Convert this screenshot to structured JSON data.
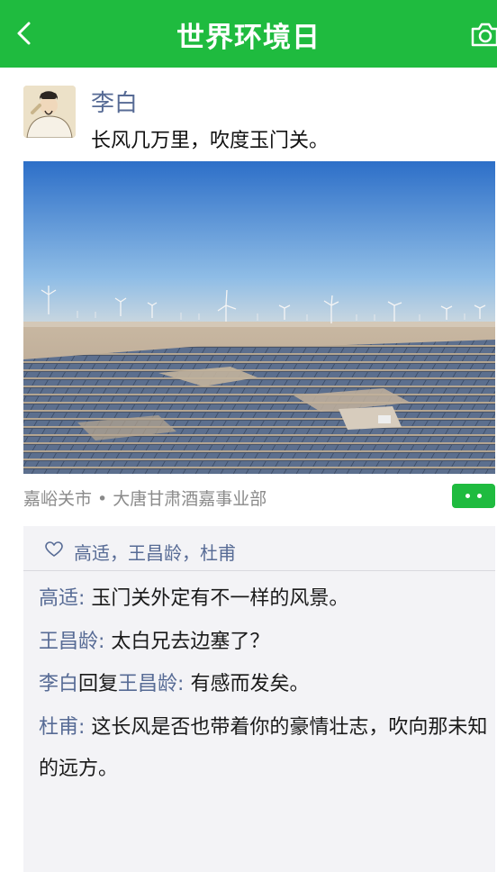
{
  "header": {
    "title": "世界环境日",
    "back_icon": "chevron-left-icon",
    "camera_icon": "camera-icon"
  },
  "colors": {
    "accent": "#1fbb3f",
    "link": "#576b95",
    "panel": "#f3f3f6"
  },
  "post": {
    "author": "李白",
    "text": "长风几万里，吹度玉门关。",
    "location": "嘉峪关市 • 大唐甘肃酒嘉事业部"
  },
  "likes": {
    "names": "高适，王昌龄，杜甫"
  },
  "comments": [
    {
      "name": "高适",
      "sep": ": ",
      "text": "玉门关外定有不一样的风景。"
    },
    {
      "name": "王昌龄",
      "sep": ": ",
      "text": "太白兄去边塞了？"
    },
    {
      "name": "李白",
      "reply_word": "回复",
      "reply_to": "王昌龄",
      "sep": ": ",
      "text": "有感而发矣。"
    },
    {
      "name": "杜甫",
      "sep": ": ",
      "text": "这长风是否也带着你的豪情壮志，吹向那未知的远方。"
    }
  ]
}
